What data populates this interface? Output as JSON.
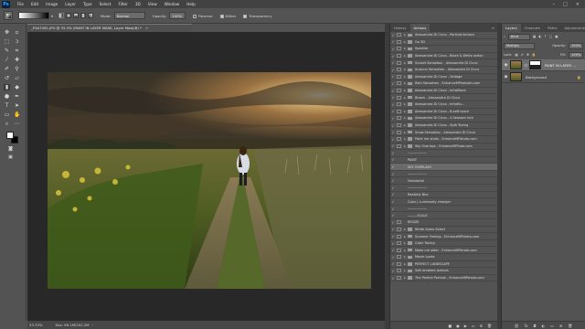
{
  "menubar": {
    "logo": "Ps",
    "items": [
      "File",
      "Edit",
      "Image",
      "Layer",
      "Type",
      "Select",
      "Filter",
      "3D",
      "View",
      "Window",
      "Help"
    ]
  },
  "options_bar": {
    "mode_label": "Mode:",
    "mode_value": "Normal",
    "opacity_label": "Opacity:",
    "opacity_value": "100%",
    "reverse_label": "Reverse",
    "dither_label": "Dither",
    "transparency_label": "Transparency"
  },
  "document_tab": {
    "title": "_P4A7491.JPG @ 33.3% (PAINT IN LAYER MASK, Layer Mask/8) *"
  },
  "status_bar": {
    "zoom": "33.33%",
    "doc": "Doc: 69.1M/102.2M"
  },
  "actions_panel": {
    "tabs": [
      "History",
      "Actions"
    ],
    "active_tab": "Actions",
    "rows": [
      {
        "check": "✓",
        "dialog": true,
        "expander": "▸",
        "type": "set",
        "name": "Alessandra Di Cicco - Portrait Actions"
      },
      {
        "check": "✓",
        "dialog": true,
        "expander": "▸",
        "type": "set",
        "name": "Go 3D"
      },
      {
        "check": "✓",
        "dialog": true,
        "expander": "▸",
        "type": "set",
        "name": "Sparkler"
      },
      {
        "check": "✓",
        "dialog": true,
        "expander": "▸",
        "type": "set",
        "name": "Alessandra Di Cicco - Black & White action"
      },
      {
        "check": "✓",
        "dialog": true,
        "expander": "▸",
        "type": "set",
        "name": "Sunset Sensation - Alessandra Di Cicco"
      },
      {
        "check": "✓",
        "dialog": true,
        "expander": "▸",
        "type": "set",
        "name": "Autumn Sensation - Alessandra Di Cicco"
      },
      {
        "check": "✓",
        "dialog": true,
        "expander": "▸",
        "type": "set",
        "name": "Alessandra Di Cicco - Vintage"
      },
      {
        "check": "✓",
        "dialog": true,
        "expander": "▸",
        "type": "set",
        "name": "Rain Sensation - EnhanceMPhotoArt.com"
      },
      {
        "check": "✓",
        "dialog": true,
        "expander": "▸",
        "type": "set",
        "name": "Alessandra Di Cicco - InfraBlack"
      },
      {
        "check": "✓",
        "dialog": true,
        "expander": "▸",
        "type": "set",
        "name": "Brown - Alessandra Di Cicco"
      },
      {
        "check": "✓",
        "dialog": true,
        "expander": "▸",
        "type": "set",
        "name": "Alessandra Di Cicco - InfraBu..."
      },
      {
        "check": "✓",
        "dialog": true,
        "expander": "▸",
        "type": "set",
        "name": "Alessandra Di Cicco - B-soft touch"
      },
      {
        "check": "✓",
        "dialog": true,
        "expander": "▸",
        "type": "set",
        "name": "Alessandra Di Cicco - 4 Seasons kick"
      },
      {
        "check": "✓",
        "dialog": true,
        "expander": "▸",
        "type": "set",
        "name": "Alessandra Di Cicco - Split Toning"
      },
      {
        "check": "✓",
        "dialog": true,
        "expander": "▸",
        "type": "set",
        "name": "Snow Sensation - Alessandra Di Cicco"
      },
      {
        "check": "✓",
        "dialog": true,
        "expander": "▸",
        "type": "set",
        "name": "Paint me shots - EnhanceMPshoto.com"
      },
      {
        "check": "✓",
        "dialog": true,
        "expander": "▸",
        "type": "set",
        "name": "Sky Overlays - EnhanceMPhoto.com"
      },
      {
        "check": "✓",
        "dialog": false,
        "expander": "",
        "type": "action",
        "name": "——————"
      },
      {
        "check": "✓",
        "dialog": false,
        "expander": "",
        "type": "action",
        "name": "PAINT"
      },
      {
        "check": "✓",
        "dialog": false,
        "expander": "",
        "type": "action",
        "name": "SKY OVERLAYS"
      },
      {
        "check": "✓",
        "dialog": false,
        "expander": "",
        "type": "action",
        "name": "——————"
      },
      {
        "check": "✓",
        "dialog": false,
        "expander": "",
        "type": "action",
        "name": "Horizontal"
      },
      {
        "check": "✓",
        "dialog": false,
        "expander": "",
        "type": "action",
        "name": "——————"
      },
      {
        "check": "✓",
        "dialog": false,
        "expander": "",
        "type": "action",
        "name": "Realistic Blur"
      },
      {
        "check": "✓",
        "dialog": false,
        "expander": "",
        "type": "action",
        "name": "Color | Luminosity changer"
      },
      {
        "check": "✓",
        "dialog": false,
        "expander": "",
        "type": "action",
        "name": "——————"
      },
      {
        "check": "✓",
        "dialog": false,
        "expander": "",
        "type": "action",
        "name": "———SCALE"
      },
      {
        "check": "✓",
        "dialog": true,
        "expander": "",
        "type": "action",
        "name": "RESIZE"
      },
      {
        "check": "✓",
        "dialog": true,
        "expander": "▸",
        "type": "set",
        "name": "White Areas Select"
      },
      {
        "check": "✓",
        "dialog": true,
        "expander": "▸",
        "type": "set",
        "name": "Summer Feeling - EnhanceMPshoto.com"
      },
      {
        "check": "✓",
        "dialog": true,
        "expander": "▸",
        "type": "set",
        "name": "Color Toning"
      },
      {
        "check": "✓",
        "dialog": true,
        "expander": "▸",
        "type": "set",
        "name": "Make me older - EnhanceMPshoto.com"
      },
      {
        "check": "✓",
        "dialog": true,
        "expander": "▸",
        "type": "set",
        "name": "Movie Looks"
      },
      {
        "check": "✓",
        "dialog": true,
        "expander": "▸",
        "type": "set",
        "name": "PERFECT LANDSCAPE"
      },
      {
        "check": "✓",
        "dialog": true,
        "expander": "▸",
        "type": "set",
        "name": "Soft Ambient Actions"
      },
      {
        "check": "✓",
        "dialog": true,
        "expander": "▸",
        "type": "set",
        "name": "The Perfect Portrait - EnhanceMPshoto.com"
      }
    ],
    "selected_row": 19
  },
  "layers_panel": {
    "tabs": [
      "Layers",
      "Channels",
      "Paths",
      "Adjustments"
    ],
    "active_tab": "Layers",
    "kind_label": "Kind",
    "blend_mode": "Multiply",
    "opacity_label": "Opacity:",
    "opacity_value": "100%",
    "lock_label": "Lock:",
    "fill_label": "Fill:",
    "fill_value": "100%",
    "layers": [
      {
        "name": "PAINT IN LAYER ...",
        "active": true
      },
      {
        "name": "Background",
        "active": false
      }
    ]
  },
  "colors": {
    "foreground": "#ffffff",
    "background": "#000000",
    "ps_blue": "#31a8ff"
  }
}
